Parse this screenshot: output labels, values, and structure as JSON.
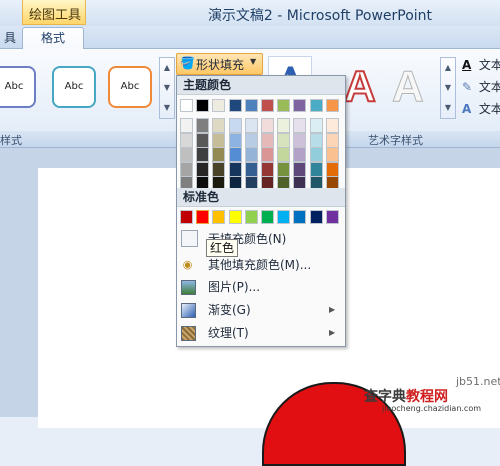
{
  "title_bar": {
    "contextual_tab_group": "绘图工具",
    "window_title": "演示文稿2 - Microsoft PowerPoint"
  },
  "tabs": {
    "partial_left": "具",
    "active": "格式"
  },
  "ribbon": {
    "shape_styles": {
      "thumbnails": [
        "Abc",
        "Abc",
        "Abc"
      ],
      "group_label": "样式"
    },
    "shape_fill_button": {
      "label": "形状填充",
      "icon": "paint-bucket-icon"
    },
    "wordart_styles": {
      "thumbnails": [
        "A",
        "A",
        "A"
      ],
      "group_label": "艺术字样式",
      "commands": [
        {
          "label": "文本",
          "icon": "text-fill-icon"
        },
        {
          "label": "文本",
          "icon": "text-outline-icon"
        },
        {
          "label": "文本",
          "icon": "text-effects-icon"
        }
      ]
    }
  },
  "dropdown": {
    "theme_colors_heading": "主题颜色",
    "theme_colors": [
      [
        "#ffffff",
        "#000000",
        "#eeece1",
        "#1f497d",
        "#4f81bd",
        "#c0504d",
        "#9bbb59",
        "#8064a2",
        "#4bacc6",
        "#f79646"
      ],
      [
        "#f2f2f2",
        "#7f7f7f",
        "#ddd9c3",
        "#c6d9f0",
        "#dbe5f1",
        "#f2dcdb",
        "#ebf1dd",
        "#e5e0ec",
        "#dbeef3",
        "#fdeada"
      ],
      [
        "#d8d8d8",
        "#595959",
        "#c4bd97",
        "#8db3e2",
        "#b8cce4",
        "#e5b9b7",
        "#d7e3bc",
        "#ccc1d9",
        "#b7dde8",
        "#fbd5b5"
      ],
      [
        "#bfbfbf",
        "#3f3f3f",
        "#938953",
        "#548dd4",
        "#95b3d7",
        "#d99694",
        "#c3d69b",
        "#b2a2c7",
        "#92cddc",
        "#fac08f"
      ],
      [
        "#a5a5a5",
        "#262626",
        "#494429",
        "#17365d",
        "#366092",
        "#953734",
        "#76923c",
        "#5f497a",
        "#31859b",
        "#e36c09"
      ],
      [
        "#7f7f7f",
        "#0c0c0c",
        "#1d1b10",
        "#0f243e",
        "#244061",
        "#632423",
        "#4f6128",
        "#3f3151",
        "#205867",
        "#974806"
      ]
    ],
    "standard_colors_heading": "标准色",
    "standard_colors": [
      "#c00000",
      "#ff0000",
      "#ffc000",
      "#ffff00",
      "#92d050",
      "#00b050",
      "#00b0f0",
      "#0070c0",
      "#002060",
      "#7030a0"
    ],
    "items": {
      "no_fill": "无填充颜色(N)",
      "more_colors": "其他填充颜色(M)...",
      "picture": "图片(P)...",
      "gradient": "渐变(G)",
      "texture": "纹理(T)"
    },
    "tooltip": "红色"
  },
  "watermark": {
    "domain": "jb51.net",
    "brand_part1": "查字典",
    "brand_part2": "教程网",
    "url": "jiaocheng.chazidian.com"
  },
  "colors": {
    "accent_fill_button": "#ffc865",
    "red_shape": "#e10f12"
  }
}
